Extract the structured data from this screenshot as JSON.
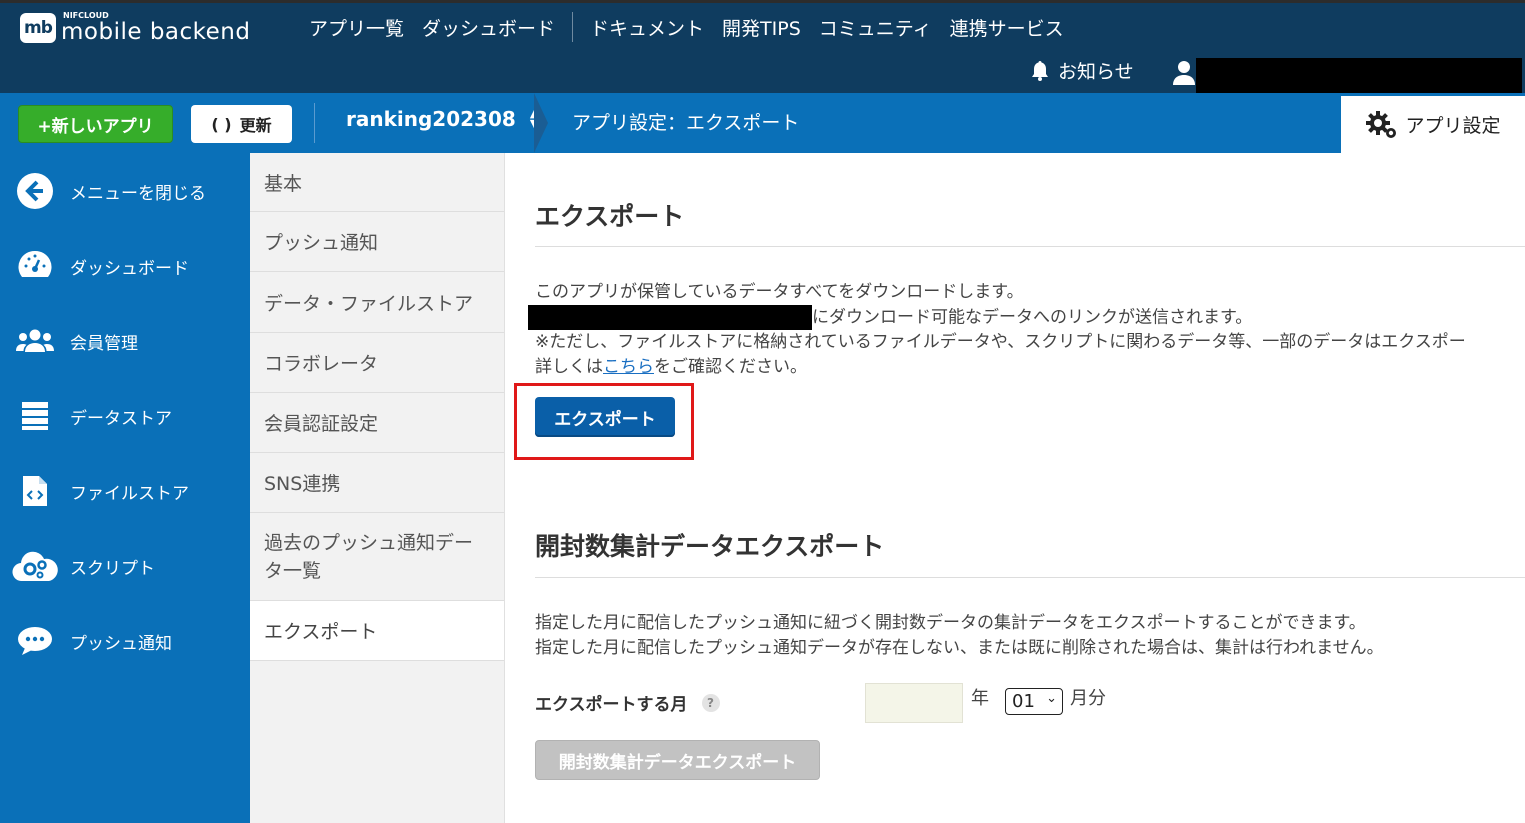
{
  "header": {
    "logo_mark": "mb",
    "logo_small": "NIFCLOUD",
    "logo_main": "mobile backend",
    "nav_left": [
      "アプリ一覧",
      "ダッシュボード"
    ],
    "nav_right": [
      "ドキュメント",
      "開発TIPS",
      "コミュニティ",
      "連携サービス"
    ],
    "notice": "お知らせ",
    "colors": {
      "header_bg": "#0f3c5f",
      "subbar_bg": "#0a70b8",
      "new_app": "#36ad2a"
    }
  },
  "subbar": {
    "new_app_label": "+新しいアプリ",
    "refresh_label": "更新",
    "app_name": "ranking202308",
    "breadcrumb": "アプリ設定：エクスポート",
    "settings_tab": "アプリ設定"
  },
  "sidebar": {
    "items": [
      {
        "label": "メニューを閉じる",
        "icon": "arrow-left-circle-icon"
      },
      {
        "label": "ダッシュボード",
        "icon": "gauge-icon"
      },
      {
        "label": "会員管理",
        "icon": "users-icon"
      },
      {
        "label": "データストア",
        "icon": "database-icon"
      },
      {
        "label": "ファイルストア",
        "icon": "file-code-icon"
      },
      {
        "label": "スクリプト",
        "icon": "cloud-gear-icon"
      },
      {
        "label": "プッシュ通知",
        "icon": "chat-bubble-icon"
      }
    ]
  },
  "submenu": {
    "items": [
      {
        "label": "基本"
      },
      {
        "label": "プッシュ通知"
      },
      {
        "label": "データ・ファイルストア"
      },
      {
        "label": "コラボレータ"
      },
      {
        "label": "会員認証設定"
      },
      {
        "label": "SNS連携"
      },
      {
        "label": "過去のプッシュ通知データ一覧"
      },
      {
        "label": "エクスポート"
      }
    ],
    "active_index": 7
  },
  "export": {
    "title": "エクスポート",
    "line1": "このアプリが保管しているデータすべてをダウンロードします。",
    "line2": "にダウンロード可能なデータへのリンクが送信されます。",
    "line3": "※ただし、ファイルストアに格納されているファイルデータや、スクリプトに関わるデータ等、一部のデータはエクスポー",
    "line4_pre": "詳しくは",
    "line4_link": "こちら",
    "line4_post": "をご確認ください。",
    "button": "エクスポート"
  },
  "open_count": {
    "title": "開封数集計データエクスポート",
    "line1": "指定した月に配信したプッシュ通知に紐づく開封数データの集計データをエクスポートすることができます。",
    "line2": "指定した月に配信したプッシュ通知データが存在しない、または既に削除された場合は、集計は行われません。",
    "month_label": "エクスポートする月",
    "help": "?",
    "year_value": "",
    "year_unit": "年",
    "month_value": "01",
    "month_unit": "月分",
    "button": "開封数集計データエクスポート"
  }
}
